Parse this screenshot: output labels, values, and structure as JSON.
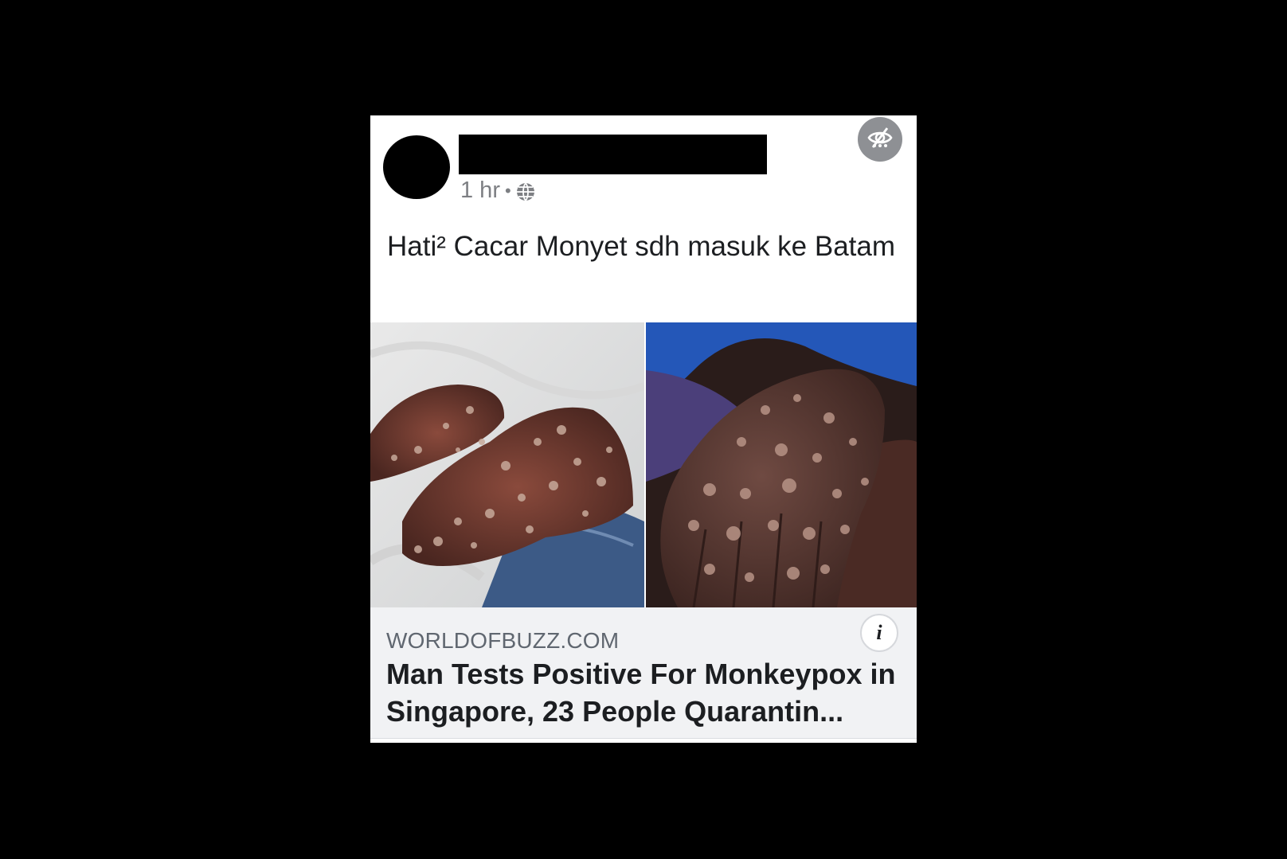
{
  "post": {
    "timestamp": "1 hr",
    "separator": "•",
    "privacy_icon": "globe-icon",
    "hide_icon": "eye-slash-icon",
    "text": "Hati² Cacar Monyet sdh masuk ke Batam"
  },
  "link_preview": {
    "domain": "WORLDOFBUZZ.COM",
    "title": "Man Tests Positive For Monkeypox in Singapore, 23 People Quarantin...",
    "info_label": "i"
  },
  "colors": {
    "page_background": "#000000",
    "card_background": "#ffffff",
    "preview_background": "#f1f2f4",
    "meta_text": "#7d7f83",
    "body_text": "#1c1e21"
  }
}
